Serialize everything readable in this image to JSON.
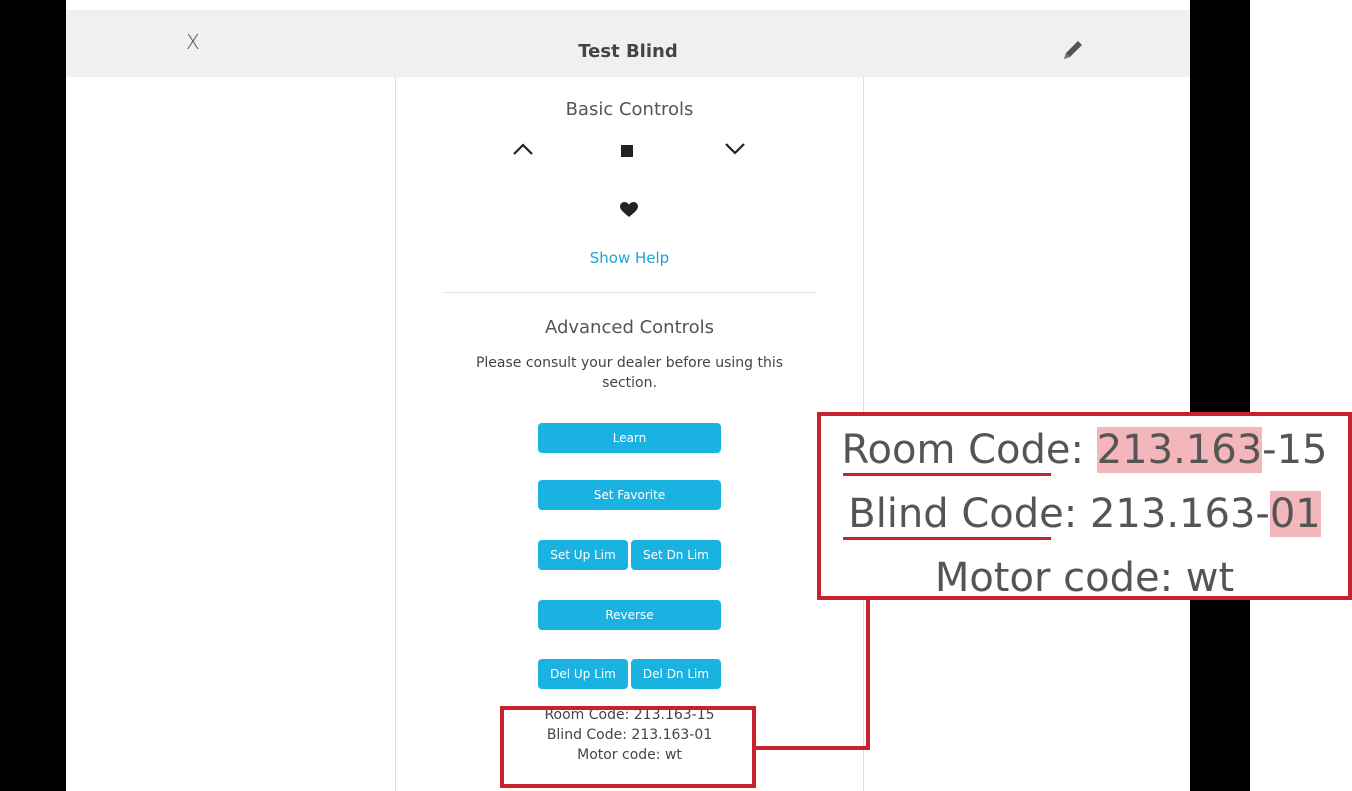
{
  "header": {
    "close_label": "X",
    "title": "Test Blind",
    "edit_icon": "pencil-icon"
  },
  "basic": {
    "title": "Basic Controls",
    "up_icon": "chevron-up-icon",
    "stop_icon": "stop-square-icon",
    "down_icon": "chevron-down-icon",
    "favorite_icon": "heart-icon",
    "help_link": "Show Help"
  },
  "advanced": {
    "title": "Advanced Controls",
    "warning": "Please consult your dealer before using this section.",
    "buttons": {
      "learn": "Learn",
      "set_favorite": "Set Favorite",
      "set_up_lim": "Set Up Lim",
      "set_dn_lim": "Set Dn Lim",
      "reverse": "Reverse",
      "del_up_lim": "Del Up Lim",
      "del_dn_lim": "Del Dn Lim"
    }
  },
  "codes": {
    "room": "Room Code: 213.163-15",
    "blind": "Blind Code: 213.163-01",
    "motor": "Motor code: wt"
  },
  "zoom": {
    "room_label": "Room Code",
    "room_sep": ": ",
    "room_highlight": "213.163",
    "room_rest": "-15",
    "blind_label": "Blind Code",
    "blind_sep": ": ",
    "blind_rest": "213.163-",
    "blind_highlight": "01",
    "motor": "Motor code: wt"
  },
  "colors": {
    "accent": "#1ab3e1",
    "link": "#1aa7d6",
    "annotation": "#c8222c",
    "highlight": "#f2b6bb"
  }
}
